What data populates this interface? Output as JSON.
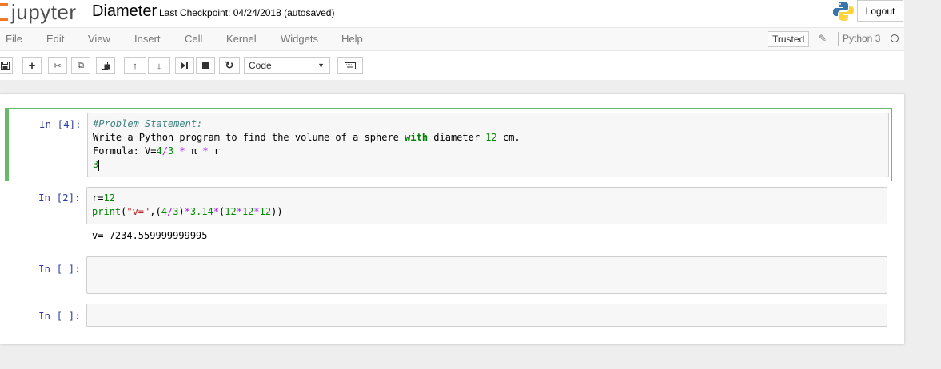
{
  "header": {
    "logo_text": "jupyter",
    "notebook_name": "Diameter",
    "checkpoint": "Last Checkpoint: 04/24/2018 (autosaved)",
    "logout_label": "Logout"
  },
  "menu": {
    "items": [
      "File",
      "Edit",
      "View",
      "Insert",
      "Cell",
      "Kernel",
      "Widgets",
      "Help"
    ],
    "trusted_label": "Trusted",
    "kernel_name": "Python 3"
  },
  "toolbar": {
    "cell_type": "Code"
  },
  "cells": [
    {
      "prompt": "In [4]:",
      "lines": [
        "#Problem Statement:",
        "Write a Python program to find the volume of a sphere with diameter 12 cm.",
        "Formula: V=4/3 * π * r",
        "3"
      ]
    },
    {
      "prompt": "In [2]:",
      "lines": [
        "r=12",
        "print(\"v=\",(4/3)*3.14*(12*12*12))"
      ],
      "output": "v= 7234.559999999995"
    },
    {
      "prompt": "In [ ]:",
      "lines": []
    },
    {
      "prompt": "In [ ]:",
      "lines": []
    }
  ],
  "colors": {
    "accent": "#f37726",
    "selected_border": "#66bb6a",
    "prompt": "#303f9f"
  }
}
